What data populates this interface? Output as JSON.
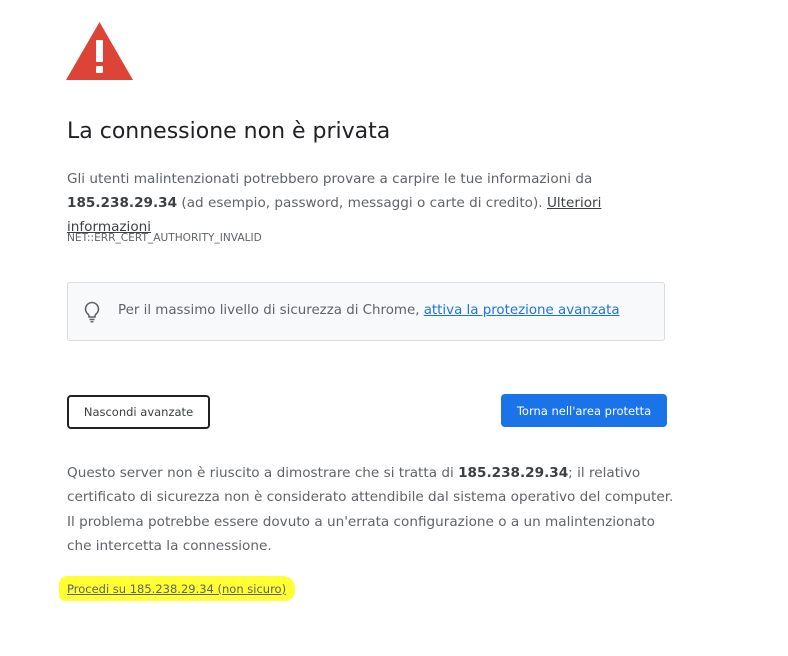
{
  "page": {
    "title": "La connessione non è privata",
    "intro_before": "Gli utenti malintenzionati potrebbero provare a carpire le tue informazioni da ",
    "host": "185.238.29.34",
    "intro_after": " (ad esempio, password, messaggi o carte di credito). ",
    "learn_more_link": "Ulteriori informazioni",
    "error_code": "NET::ERR_CERT_AUTHORITY_INVALID"
  },
  "protection": {
    "text": "Per il massimo livello di sicurezza di Chrome, ",
    "link": "attiva la protezione avanzata"
  },
  "buttons": {
    "hide_advanced": "Nascondi avanzate",
    "back_to_safety": "Torna nell'area protetta"
  },
  "details": {
    "before": "Questo server non è riuscito a dimostrare che si tratta di ",
    "host": "185.238.29.34",
    "after": "; il relativo certificato di sicurezza non è considerato attendibile dal sistema operativo del computer. Il problema potrebbe essere dovuto a un'errata configurazione o a un malintenzionato che intercetta la connessione.",
    "proceed_link": "Procedi su 185.238.29.34 (non sicuro)"
  },
  "icons": {
    "warning": "warning-triangle-icon",
    "bulb": "lightbulb-icon"
  },
  "colors": {
    "warning_red": "#db4437",
    "primary_blue": "#1a73e8",
    "highlight_yellow": "#ffff33",
    "text_gray": "#5f6368"
  }
}
